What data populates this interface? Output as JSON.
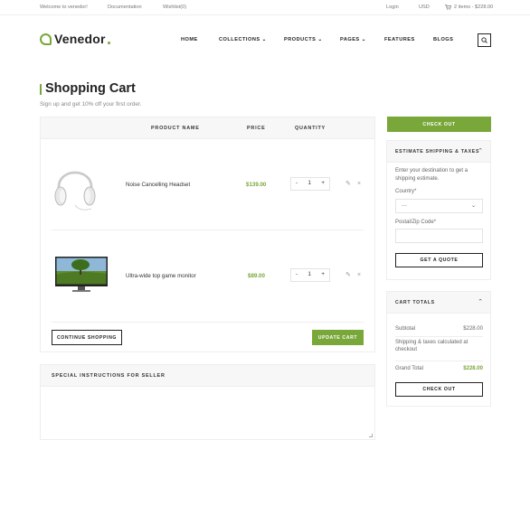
{
  "topbar": {
    "welcome": "Welcome to venedor!",
    "documentation": "Documentation",
    "wishlist": "Wishlist(0)",
    "login": "Login",
    "currency": "USD",
    "cart_summary": "2 items - $228.00"
  },
  "header": {
    "logo": "Venedor",
    "nav": [
      "HOME",
      "COLLECTIONS",
      "PRODUCTS",
      "PAGES",
      "FEATURES",
      "BLOGS"
    ]
  },
  "page": {
    "title": "Shopping Cart",
    "subtitle": "Sign up and get 10% off your first order."
  },
  "cart": {
    "columns": [
      "PRODUCT NAME",
      "PRICE",
      "QUANTITY"
    ],
    "items": [
      {
        "name": "Noise Cancelling Headset",
        "price": "$139.00",
        "qty": "1",
        "image": "headphones-image"
      },
      {
        "name": "Ultra-wide top game monitor",
        "price": "$89.00",
        "qty": "1",
        "image": "monitor-image"
      }
    ],
    "minus": "-",
    "plus": "+",
    "continue_label": "CONTINUE SHOPPING",
    "update_label": "UPDATE CART"
  },
  "special": {
    "title": "SPECIAL INSTRUCTIONS FOR SELLER"
  },
  "sidebar": {
    "checkout_label": "CHECK OUT",
    "shipping": {
      "title": "ESTIMATE SHIPPING & TAXES",
      "intro": "Enter your destination to get a shipping estimate.",
      "country_label": "Country*",
      "country_value": "---",
      "zip_label": "Postal/Zip Code*",
      "quote_label": "GET A QUOTE"
    },
    "totals": {
      "title": "CART TOTALS",
      "subtotal_label": "Subtotal",
      "subtotal_value": "$228.00",
      "shipping_note": "Shipping & taxes calculated at checkout",
      "grand_label": "Grand Total",
      "grand_value": "$228.00",
      "checkout_label": "CHECK OUT"
    }
  },
  "colors": {
    "accent": "#79a73a",
    "text": "#222222",
    "muted": "#888888"
  }
}
